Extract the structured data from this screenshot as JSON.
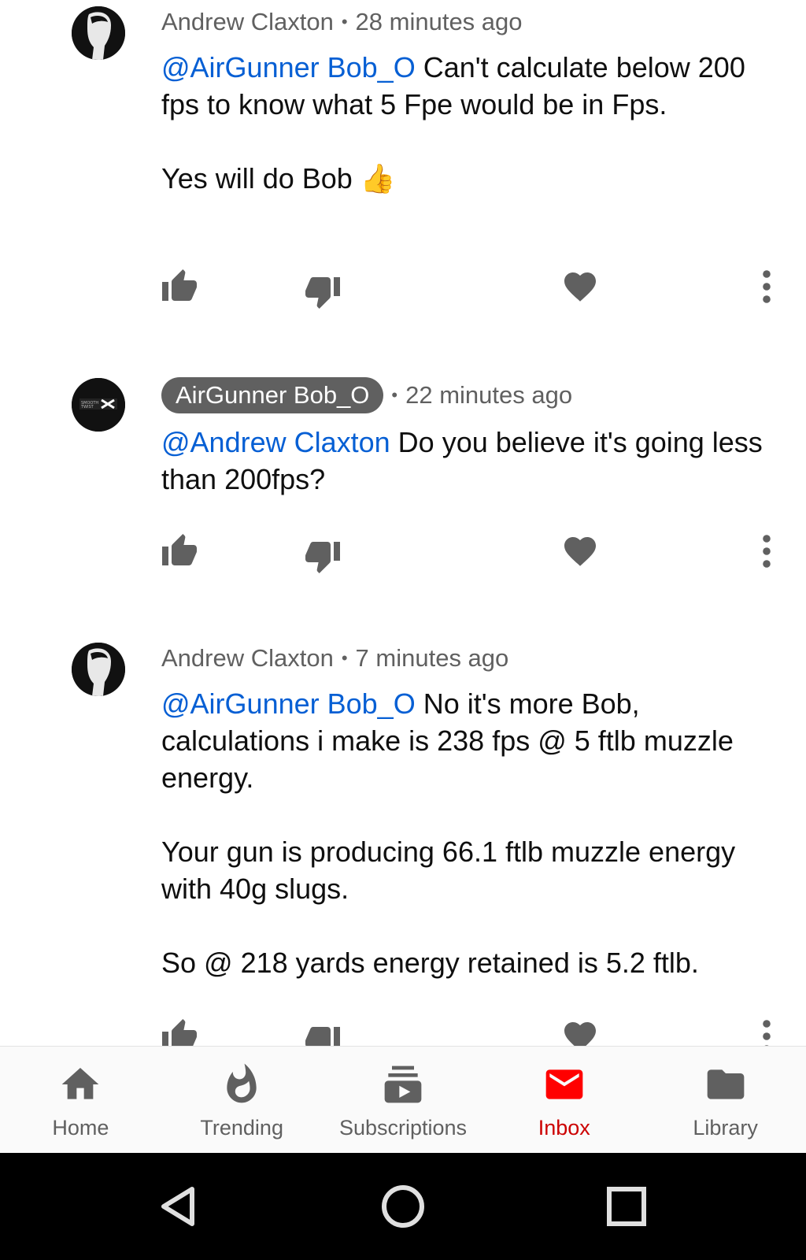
{
  "comments": [
    {
      "author": "Andrew Claxton",
      "time": "28 minutes ago",
      "mention": "@AirGunner Bob_O",
      "text": " Can't calculate below 200 fps to know what 5 Fpe would be in Fps.\n\nYes will do Bob 👍",
      "avatar": "andrew-avatar"
    },
    {
      "author": "AirGunner Bob_O",
      "time": "22 minutes ago",
      "mention": "@Andrew Claxton",
      "text": " Do you believe it's going less than 200fps?",
      "avatar": "airgunner-avatar"
    },
    {
      "author": "Andrew Claxton",
      "time": "7 minutes ago",
      "mention": "@AirGunner Bob_O",
      "text": " No it's more Bob, calculations i make is 238 fps @ 5 ftlb muzzle energy.\n\nYour gun is producing 66.1 ftlb muzzle energy with 40g slugs.\n\nSo @ 218 yards energy retained is 5.2 ftlb.",
      "avatar": "andrew-avatar"
    }
  ],
  "separator": "•",
  "nav": {
    "items": [
      {
        "label": "Home",
        "icon": "home-icon"
      },
      {
        "label": "Trending",
        "icon": "fire-icon"
      },
      {
        "label": "Subscriptions",
        "icon": "subscriptions-icon"
      },
      {
        "label": "Inbox",
        "icon": "mail-icon",
        "active": true
      },
      {
        "label": "Library",
        "icon": "folder-icon"
      }
    ]
  },
  "colors": {
    "mention": "#065fd4",
    "active_nav": "#ff0000",
    "icon_gray": "#606060"
  },
  "system_nav": [
    "back-icon",
    "home-circle-icon",
    "recents-icon"
  ]
}
